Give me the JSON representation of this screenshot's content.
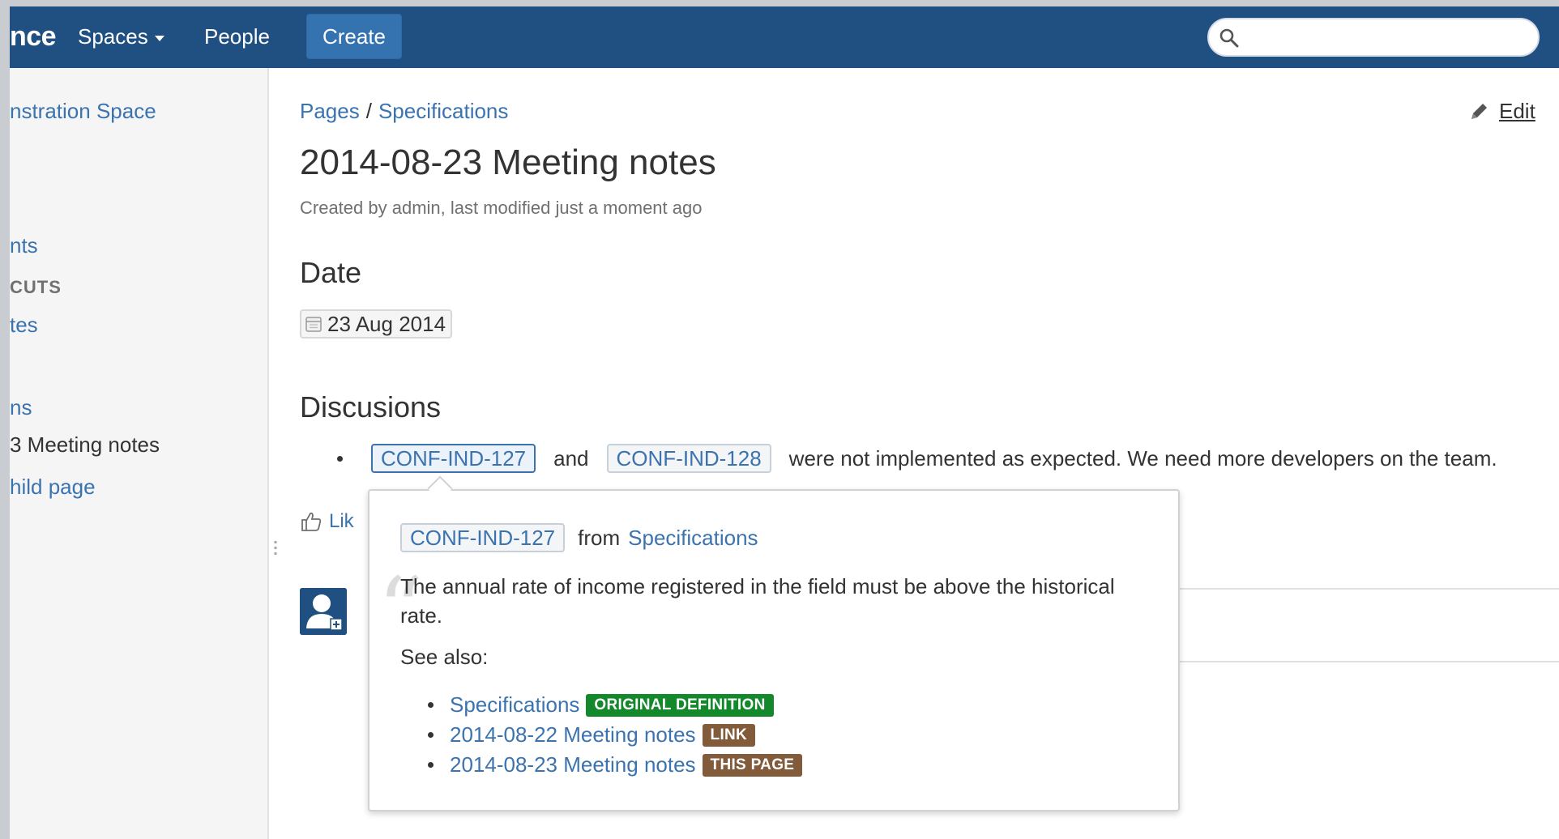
{
  "nav": {
    "logo_text": "nce",
    "spaces": "Spaces",
    "people": "People",
    "create": "Create",
    "search_placeholder": ""
  },
  "sidebar": {
    "space_name": "nstration Space",
    "items": [
      {
        "label": "nts"
      },
      {
        "label": "CUTS"
      },
      {
        "label": "tes"
      },
      {
        "label": "ns"
      },
      {
        "label": "3 Meeting notes"
      },
      {
        "label": "hild page"
      }
    ]
  },
  "breadcrumb": {
    "pages": "Pages",
    "sep": "/",
    "specifications": "Specifications"
  },
  "edit_label": "Edit",
  "page": {
    "title": "2014-08-23 Meeting notes",
    "byline": "Created by admin, last modified just a moment ago"
  },
  "date_section": {
    "heading": "Date",
    "value": "23 Aug 2014"
  },
  "discussions": {
    "heading": "Discusions",
    "tag1": "CONF-IND-127",
    "and": "and",
    "tag2": "CONF-IND-128",
    "rest": "were not implemented as expected. We need more developers on the team."
  },
  "like_label": "Lik",
  "popup": {
    "tag": "CONF-IND-127",
    "from": "from",
    "from_link": "Specifications",
    "body": "The annual rate of income registered in the field must be above the historical rate.",
    "see_also": "See also:",
    "links": [
      {
        "label": "Specifications",
        "badge": "ORIGINAL DEFINITION",
        "badge_color": "#14892c"
      },
      {
        "label": "2014-08-22 Meeting notes",
        "badge": "LINK",
        "badge_color": "#815b3a"
      },
      {
        "label": "2014-08-23 Meeting notes",
        "badge": "THIS PAGE",
        "badge_color": "#815b3a"
      }
    ]
  },
  "colors": {
    "header": "#205081",
    "link": "#3b73af",
    "create_button": "#3572b0"
  }
}
